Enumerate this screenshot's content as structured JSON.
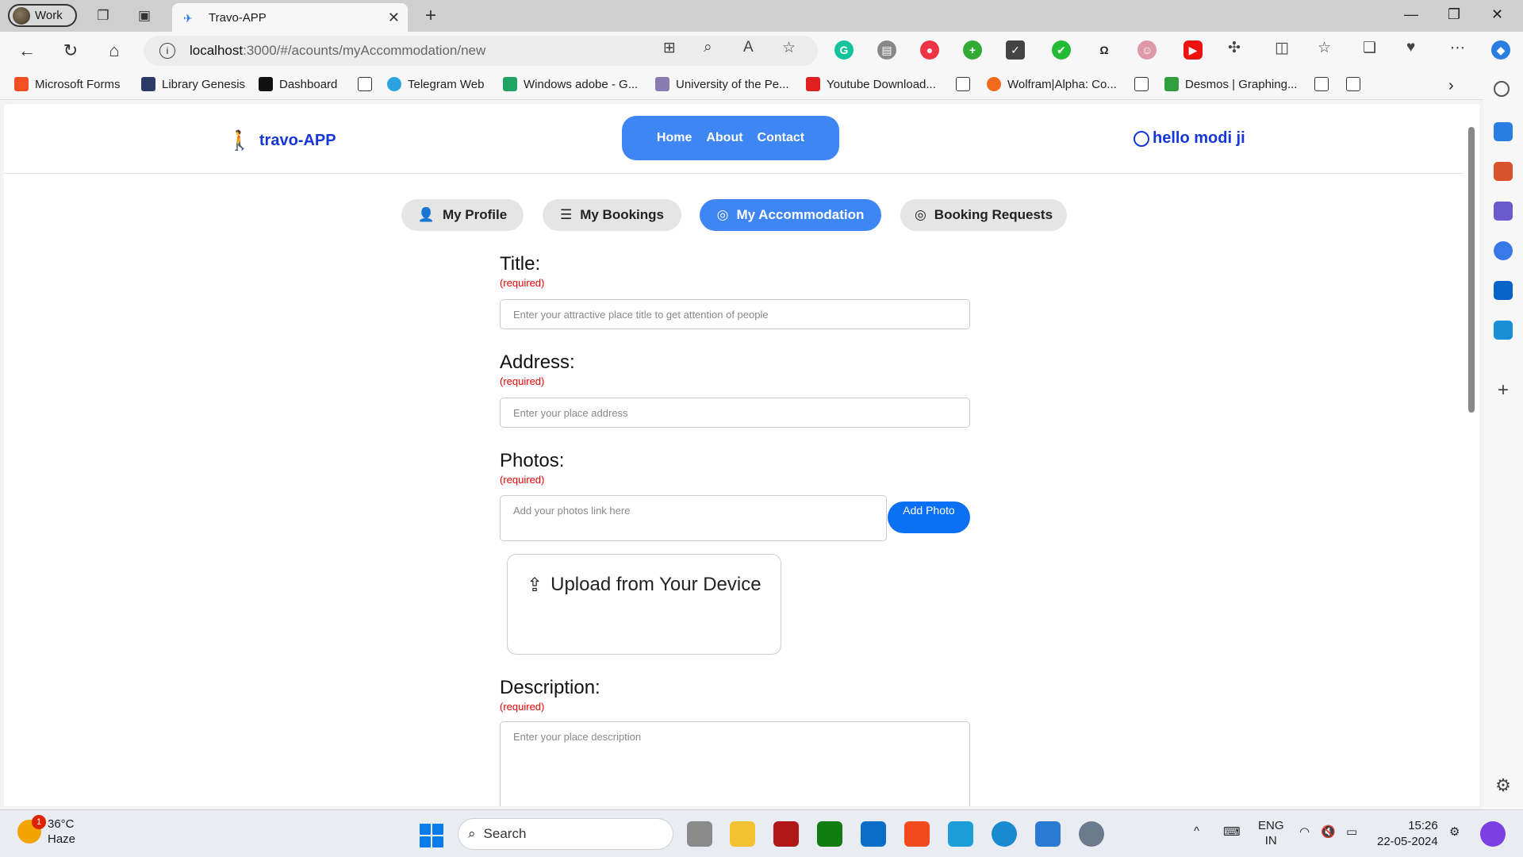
{
  "browser": {
    "profile_label": "Work",
    "tab_title": "Travo-APP",
    "url_host": "localhost",
    "url_rest": ":3000/#/acounts/myAccommodation/new"
  },
  "bookmarks": [
    {
      "label": "Microsoft Forms",
      "color": "#f25022"
    },
    {
      "label": "Library Genesis",
      "color": "#2b3a67"
    },
    {
      "label": "Dashboard",
      "color": "#111111"
    },
    {
      "label": "Telegram Web",
      "color": "#2aa3e0"
    },
    {
      "label": "Windows adobe - G...",
      "color": "#1fa463"
    },
    {
      "label": "University of the Pe...",
      "color": "#8a7bb0"
    },
    {
      "label": "Youtube Download...",
      "color": "#e02020"
    },
    {
      "label": "Wolfram|Alpha: Co...",
      "color": "#f26b1d"
    },
    {
      "label": "Desmos | Graphing...",
      "color": "#2e9e3f"
    }
  ],
  "app": {
    "logo_text": "travo-APP",
    "nav": {
      "home": "Home",
      "about": "About",
      "contact": "Contact"
    },
    "user_greeting": "hello modi ji",
    "subnav": {
      "profile": "My Profile",
      "bookings": "My Bookings",
      "accommodation": "My Accommodation",
      "requests": "Booking Requests"
    },
    "form": {
      "title_label": "Title:",
      "title_required": "(required)",
      "title_placeholder": "Enter your attractive place title to get attention of people",
      "address_label": "Address:",
      "address_required": "(required)",
      "address_placeholder": "Enter your place address",
      "photos_label": "Photos:",
      "photos_required": "(required)",
      "photos_placeholder": "Add your photos link here",
      "add_photo": "Add Photo",
      "upload_label": "Upload from Your Device",
      "description_label": "Description:",
      "description_required": "(required)",
      "description_placeholder": "Enter your place description"
    }
  },
  "taskbar": {
    "weather_temp": "36°C",
    "weather_desc": "Haze",
    "weather_badge": "1",
    "search_label": "Search",
    "lang_line1": "ENG",
    "lang_line2": "IN",
    "time": "15:26",
    "date": "22-05-2024"
  },
  "colors": {
    "accent": "#3f86f5",
    "brand_text": "#1536d8",
    "required": "#e00000"
  }
}
